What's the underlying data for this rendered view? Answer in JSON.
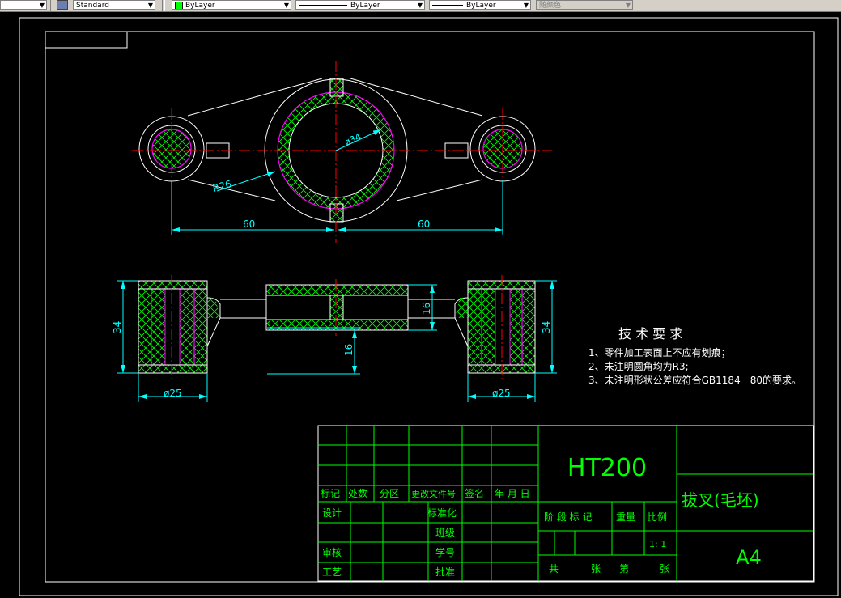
{
  "toolbar": {
    "text_style": "Standard",
    "layer": "ByLayer",
    "linetype": "ByLayer",
    "lineweight": "ByLayer",
    "plot_color": "随颜色"
  },
  "dimensions": {
    "hole_dia": "ø34",
    "radius": "R26",
    "left_spacing": "60",
    "right_spacing": "60",
    "height_left": "34",
    "height_right": "34",
    "web_height": "16",
    "rib_thickness": "16",
    "boss_dia_left": "ø25",
    "boss_dia_right": "ø25"
  },
  "tech_requirements": {
    "title": "技 术 要 求",
    "items": [
      "1、零件加工表面上不应有划痕；",
      "2、未注明圆角均为R3;",
      "3、未注明形状公差应符合GB1184－80的要求。"
    ]
  },
  "title_block": {
    "material": "HT200",
    "part_name": "拔叉(毛坯)",
    "sheet_size": "A4",
    "scale": "1: 1",
    "rev_headers": [
      "标记",
      "处数",
      "分区",
      "更改文件号",
      "签名",
      "年 月 日"
    ],
    "roles_left": [
      "设计",
      "审核",
      "工艺"
    ],
    "roles_mid": [
      "标准化",
      "班级",
      "学号",
      "批准"
    ],
    "stage_label": "阶 段 标 记",
    "weight_label": "重量",
    "ratio_label": "比例",
    "sheets": [
      "共",
      "张",
      "第",
      "张"
    ]
  }
}
